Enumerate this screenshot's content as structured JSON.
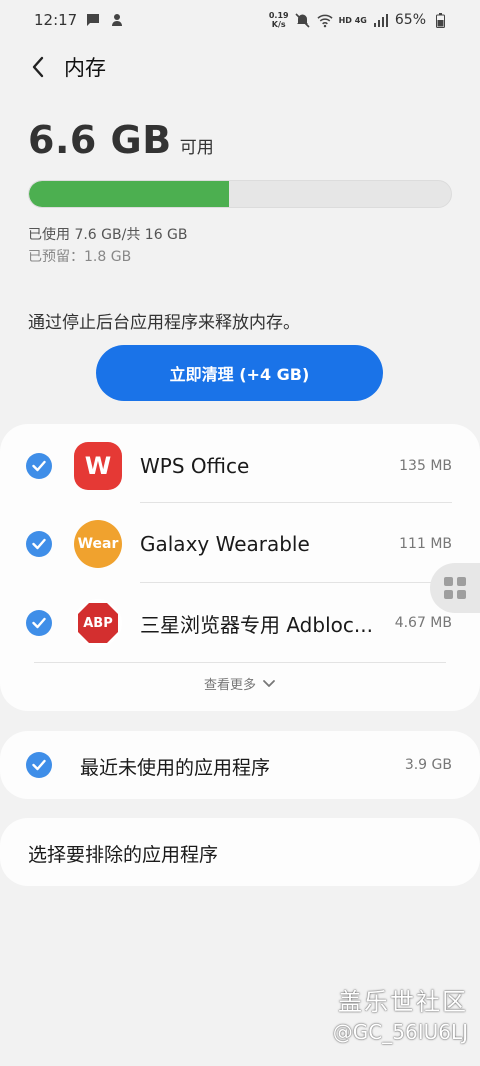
{
  "status_bar": {
    "time": "12:17",
    "net_speed_value": "0.19",
    "net_speed_unit": "K/s",
    "network": "HD 4G",
    "battery": "65%"
  },
  "header": {
    "title": "内存"
  },
  "memory": {
    "available_value": "6.6 GB",
    "available_label": "可用",
    "used_fraction": 0.475,
    "used_text": "已使用 7.6 GB/共 16 GB",
    "reserved_text": "已预留：1.8 GB",
    "bar_color": "#4caf50"
  },
  "description": "通过停止后台应用程序来释放内存。",
  "clean_button": {
    "label": "立即清理 (+4 GB)",
    "color": "#1a73e8"
  },
  "apps": [
    {
      "name": "WPS Office",
      "size": "135 MB",
      "icon": "wps-office-icon",
      "icon_text": "W",
      "color": "#e53935",
      "checked": true
    },
    {
      "name": "Galaxy Wearable",
      "size": "111 MB",
      "icon": "galaxy-wearable-icon",
      "icon_text": "Wear",
      "color": "#f0a22e",
      "checked": true
    },
    {
      "name": "三星浏览器专用 Adbloc...",
      "size": "4.67 MB",
      "icon": "abp-icon",
      "icon_text": "ABP",
      "color": "#d32f2f",
      "checked": true
    }
  ],
  "see_more": "查看更多",
  "recent_unused": {
    "label": "最近未使用的应用程序",
    "size": "3.9 GB",
    "checked": true
  },
  "exclude": {
    "label": "选择要排除的应用程序"
  },
  "watermark": {
    "line1": "盖乐世社区",
    "line2": "@GC_56IU6LJ"
  }
}
